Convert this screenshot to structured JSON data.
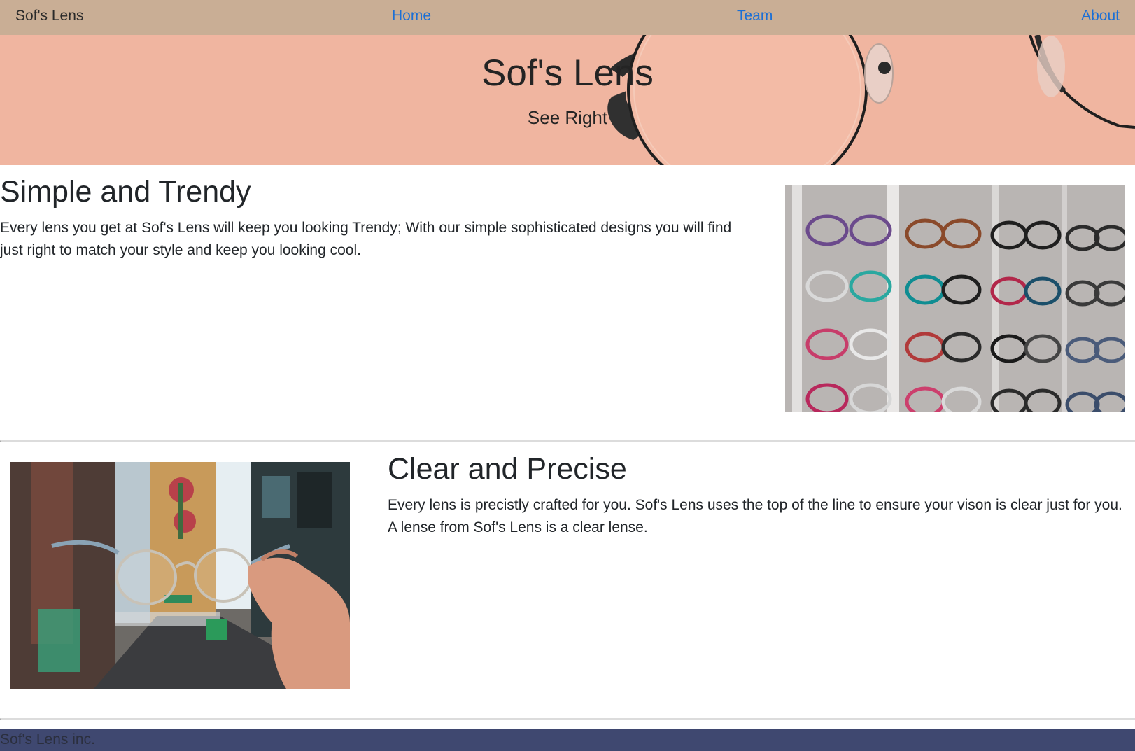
{
  "navbar": {
    "brand": "Sof's Lens",
    "links": [
      {
        "label": "Home"
      },
      {
        "label": "Team"
      },
      {
        "label": "About"
      }
    ],
    "background": "#c9ae95",
    "link_color": "#1a6fd6"
  },
  "hero": {
    "title": "Sof's Lens",
    "subtitle": "See Right",
    "image": "round-glasses-photo"
  },
  "features": [
    {
      "heading": "Simple and Trendy",
      "text": "Every lens you get at Sof's Lens will keep you looking Trendy; With our simple sophisticated designs you will find just right to match your style and keep you looking cool.",
      "image": "eyeglasses-display-wall-photo"
    },
    {
      "heading": "Clear and Precise",
      "text": "Every lens is precistly crafted for you. Sof's Lens uses the top of the line to ensure your vison is clear just for you. A lense from Sof's Lens is a clear lense.",
      "image": "hand-holding-glasses-photo"
    }
  ],
  "footer": {
    "text": "Sof's Lens inc.",
    "background": "#3f4870"
  }
}
